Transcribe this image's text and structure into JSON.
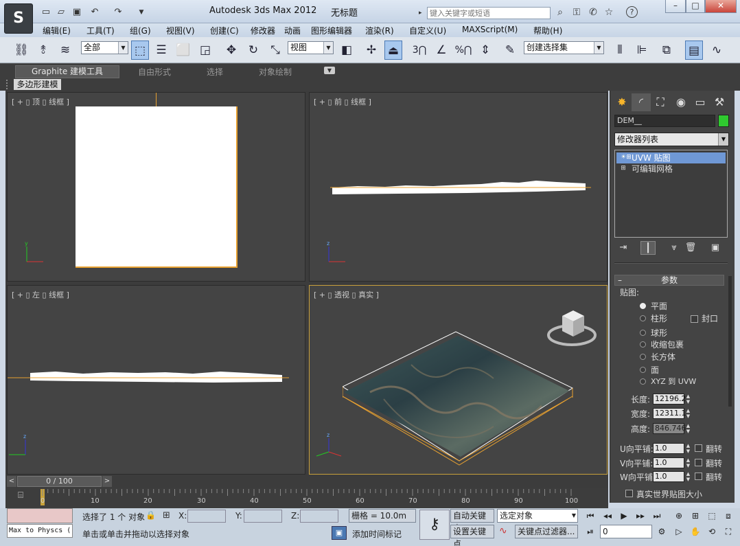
{
  "titlebar": {
    "logo": "S",
    "title": "Autodesk 3ds Max  2012",
    "doc": "无标题",
    "search_placeholder": "键入关键字或短语",
    "minimize": "–",
    "maximize": "□",
    "close": "✕",
    "help": "?"
  },
  "menu": [
    "编辑(E)",
    "工具(T)",
    "组(G)",
    "视图(V)",
    "创建(C)",
    "修改器",
    "动画",
    "图形编辑器",
    "渲染(R)",
    "自定义(U)",
    "MAXScript(M)",
    "帮助(H)"
  ],
  "toolbar": {
    "selection_filter": "全部",
    "ref_coord": "视图",
    "named_selection": "创建选择集",
    "snap_3": "3",
    "percent": "%"
  },
  "ribbon": {
    "tabs": [
      "Graphite 建模工具",
      "自由形式",
      "选择",
      "对象绘制"
    ],
    "sub": "多边形建模"
  },
  "viewports": {
    "top": "[ + ▯ 顶 ▯ 线框 ]",
    "front": "[ + ▯ 前 ▯ 线框 ]",
    "left": "[ + ▯ 左 ▯ 线框 ]",
    "persp": "[ + ▯ 透视 ▯ 真实 ]",
    "axis_x": "x",
    "axis_y": "y",
    "axis_z": "z"
  },
  "command_panel": {
    "object_name": "DEM__",
    "object_color": "#2fc82f",
    "modifier_list": "修改器列表",
    "stack": [
      "UVW 贴图",
      "可编辑网格"
    ],
    "rollout_title": "参数",
    "mapping_label": "贴图:",
    "mapping": [
      "平面",
      "柱形",
      "球形",
      "收缩包裹",
      "长方体",
      "面",
      "XYZ 到 UVW"
    ],
    "cap_label": "封口",
    "length_label": "长度:",
    "length": "12196.2",
    "width_label": "宽度:",
    "width": "12311.1",
    "height_label": "高度:",
    "height": "846.746",
    "u_tile_label": "U向平铺:",
    "u_tile": "1.0",
    "v_tile_label": "V向平铺:",
    "v_tile": "1.0",
    "w_tile_label": "W向平铺:",
    "w_tile": "1.0",
    "flip_label": "翻转",
    "real_world_label": "真实世界贴图大小"
  },
  "timeline": {
    "frame": "0 / 100",
    "ticks": [
      "0",
      "10",
      "20",
      "30",
      "40",
      "50",
      "60",
      "70",
      "80",
      "90",
      "100"
    ]
  },
  "status": {
    "script_listener": "Max to Physcs (",
    "selected": "选择了 1 个 对象",
    "x_label": "X:",
    "y_label": "Y:",
    "z_label": "Z:",
    "grid": "栅格 = 10.0m",
    "prompt": "单击或单击并拖动以选择对象",
    "add_time_tag": "添加时间标记",
    "auto_key": "自动关键点",
    "set_key": "设置关键点",
    "selected_set": "选定对象",
    "key_filters": "关键点过滤器...",
    "frame_value": "0"
  }
}
